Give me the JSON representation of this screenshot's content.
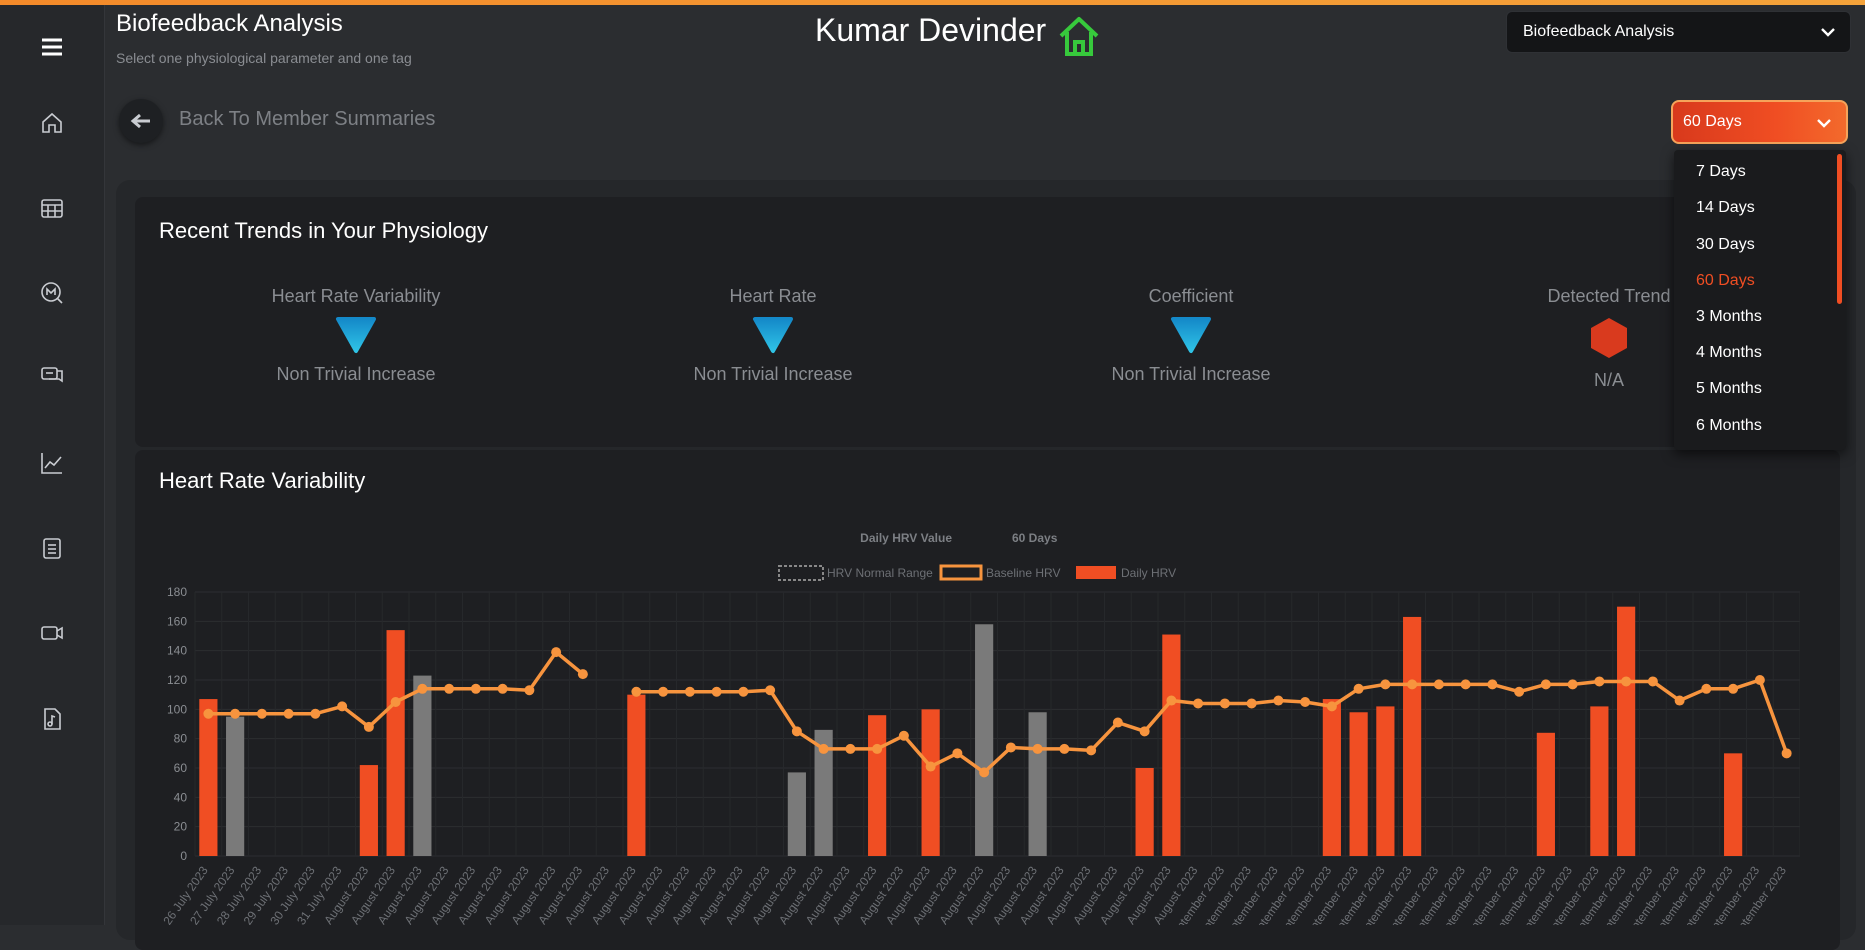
{
  "header": {
    "page_title": "Biofeedback Analysis",
    "page_subtitle": "Select one physiological parameter and one tag",
    "member_name": "Kumar Devinder",
    "analysis_select": "Biofeedback Analysis"
  },
  "back": {
    "label": "Back To Member Summaries"
  },
  "period_select": {
    "value": "60 Days",
    "options": [
      "7 Days",
      "14 Days",
      "30 Days",
      "60 Days",
      "3 Months",
      "4 Months",
      "5 Months",
      "6 Months"
    ],
    "selected_color": "#f04e23"
  },
  "sidebar": {
    "icons": [
      "menu-icon",
      "home-icon",
      "calendar-icon",
      "chat-m-icon",
      "messages-icon",
      "trend-chart-icon",
      "clipboard-icon",
      "video-call-icon",
      "audio-file-icon"
    ]
  },
  "trends": {
    "title": "Recent Trends in Your Physiology",
    "items": [
      {
        "label": "Heart Rate Variability",
        "value": "Non Trivial Increase"
      },
      {
        "label": "Heart Rate",
        "value": "Non Trivial Increase"
      },
      {
        "label": "Coefficient",
        "value": "Non Trivial Increase"
      },
      {
        "label": "Detected Trend",
        "value": "N/A"
      }
    ]
  },
  "hrv_section": {
    "title": "Heart Rate Variability"
  },
  "colors": {
    "accent": "#f04e23",
    "line": "#f7943e",
    "gray": "#7a7a7a",
    "trend_blue": "#1fa6d8"
  },
  "chart_data": {
    "type": "bar",
    "title": "Daily HRV Value",
    "subtitle": "60 Days",
    "legend": [
      "HRV Normal Range",
      "Baseline HRV",
      "Daily HRV"
    ],
    "ylim": [
      0,
      180
    ],
    "yticks": [
      0,
      20,
      40,
      60,
      80,
      100,
      120,
      140,
      160,
      180
    ],
    "categories": [
      "26 July 2023",
      "27 July 2023",
      "28 July 2023",
      "29 July 2023",
      "30 July 2023",
      "31 July 2023",
      "August 2023",
      "August 2023",
      "August 2023",
      "August 2023",
      "August 2023",
      "August 2023",
      "August 2023",
      "August 2023",
      "August 2023",
      "August 2023",
      "August 2023",
      "August 2023",
      "August 2023",
      "August 2023",
      "August 2023",
      "August 2023",
      "August 2023",
      "August 2023",
      "August 2023",
      "August 2023",
      "August 2023",
      "August 2023",
      "August 2023",
      "August 2023",
      "August 2023",
      "August 2023",
      "August 2023",
      "August 2023",
      "August 2023",
      "August 2023",
      "August 2023",
      "August 2023",
      "September 2023",
      "September 2023",
      "September 2023",
      "September 2023",
      "September 2023",
      "September 2023",
      "September 2023",
      "September 2023",
      "September 2023",
      "September 2023",
      "September 2023",
      "September 2023",
      "September 2023",
      "September 2023",
      "September 2023",
      "September 2023",
      "September 2023",
      "September 2023",
      "September 2023",
      "September 2023",
      "September 2023",
      "September 2023"
    ],
    "daily_hrv": [
      107,
      95,
      null,
      null,
      null,
      null,
      62,
      154,
      123,
      null,
      null,
      null,
      null,
      null,
      null,
      null,
      110,
      null,
      null,
      null,
      null,
      null,
      57,
      86,
      null,
      96,
      null,
      100,
      null,
      158,
      null,
      98,
      null,
      null,
      null,
      60,
      151,
      null,
      null,
      null,
      null,
      null,
      107,
      98,
      102,
      163,
      null,
      null,
      null,
      null,
      84,
      null,
      102,
      170,
      null,
      null,
      null,
      70,
      null,
      null
    ],
    "gray_days": [
      1,
      8,
      22,
      23,
      29,
      31
    ],
    "baseline_hrv": [
      97,
      97,
      97,
      97,
      97,
      102,
      88,
      105,
      114,
      114,
      114,
      114,
      113,
      139,
      124,
      null,
      112,
      112,
      112,
      112,
      112,
      113,
      85,
      73,
      73,
      73,
      82,
      61,
      70,
      57,
      74,
      73,
      73,
      72,
      91,
      85,
      106,
      104,
      104,
      104,
      106,
      105,
      102,
      114,
      117,
      117,
      117,
      117,
      117,
      112,
      117,
      117,
      119,
      119,
      119,
      106,
      114,
      114,
      120,
      70,
      70
    ]
  }
}
